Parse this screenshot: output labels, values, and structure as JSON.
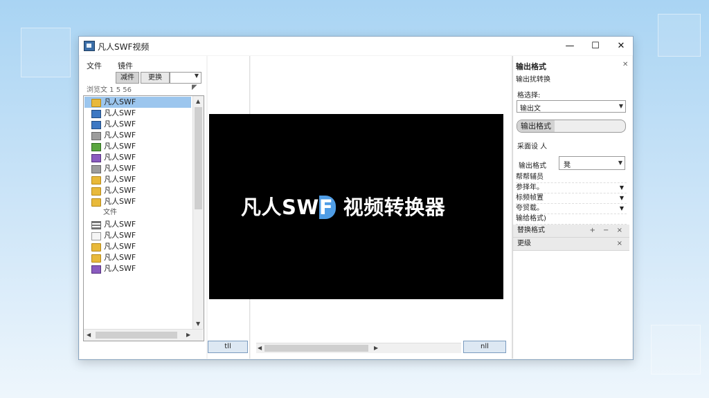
{
  "window": {
    "title": "凡人SWF视频"
  },
  "menu": {
    "file": "文件",
    "edit": "镜件"
  },
  "left_panel": {
    "tabs": [
      "减件",
      "更换"
    ],
    "breadcrumb": "浏览文 1 5 56",
    "tree": [
      {
        "label": "凡人SWF",
        "icon": "folder-icon",
        "selected": true
      },
      {
        "label": "凡人SWF",
        "icon": "swf-file-icon"
      },
      {
        "label": "凡人SWF",
        "icon": "tool-icon"
      },
      {
        "label": "凡人SWF",
        "icon": "brush-icon"
      },
      {
        "label": "凡人SWF",
        "icon": "image-icon"
      },
      {
        "label": "凡人SWF",
        "icon": "media-icon"
      },
      {
        "label": "凡人SWF",
        "icon": "pen-icon"
      },
      {
        "label": "凡人SWF",
        "icon": "folder-icon"
      },
      {
        "label": "凡人SWF",
        "icon": "folder-icon"
      },
      {
        "label": "凡人SWF",
        "icon": "folder-icon"
      },
      {
        "label": "文件",
        "icon": "",
        "group": true
      },
      {
        "label": "凡人SWF",
        "icon": "list-icon"
      },
      {
        "label": "凡人SWF",
        "icon": "window-icon"
      },
      {
        "label": "凡人SWF",
        "icon": "folder-icon"
      },
      {
        "label": "凡人SWF",
        "icon": "folder-icon"
      },
      {
        "label": "凡人SWF",
        "icon": "paint-icon"
      }
    ]
  },
  "preview": {
    "text_main": "凡人SW",
    "text_accent": "F",
    "text_tail": " 视频转换器",
    "left_button": "tll",
    "right_button": "nll"
  },
  "right_panel": {
    "header": "输出格式",
    "subheader": "输出扰转换",
    "select_label": "格选择:",
    "select_value": "输出文",
    "output_format_btn": "输出格式",
    "section_title": "采面设 人",
    "format_label": "输出格式",
    "format_value": "凳",
    "props": [
      "帮帮辅员",
      "参择年。",
      "标频帧置",
      "夸贸载。",
      "输给格式)"
    ],
    "list": [
      {
        "label": "替换格式",
        "actions": "+ − ×"
      },
      {
        "label": "更级",
        "actions": "×"
      }
    ]
  }
}
